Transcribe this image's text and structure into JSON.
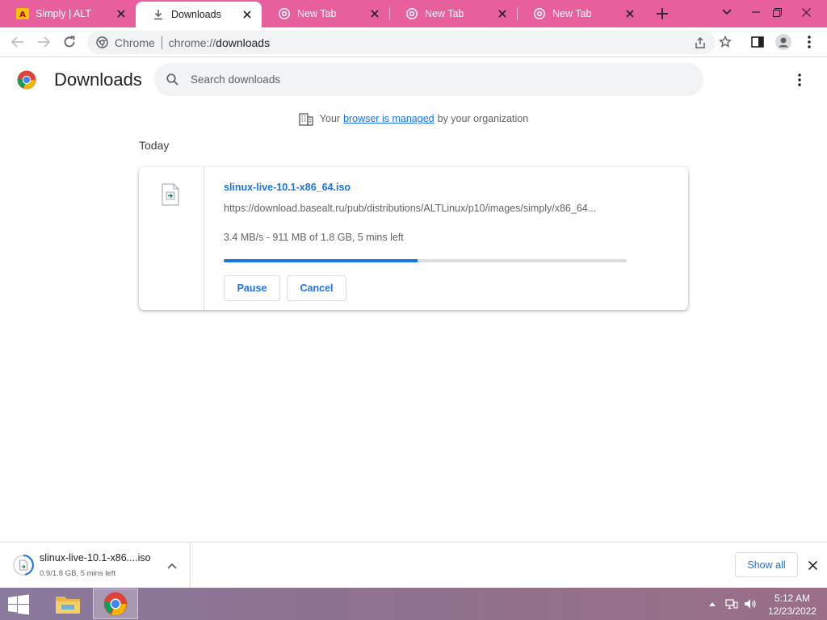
{
  "tabs": [
    {
      "title": "Simply | ALT",
      "icon": "alt-linux-icon",
      "active": false
    },
    {
      "title": "Downloads",
      "icon": "download-icon",
      "active": true
    },
    {
      "title": "New Tab",
      "icon": "chrome-icon",
      "active": false
    },
    {
      "title": "New Tab",
      "icon": "chrome-icon",
      "active": false
    },
    {
      "title": "New Tab",
      "icon": "chrome-icon",
      "active": false
    }
  ],
  "colors": {
    "tabstrip": "#e7609d",
    "accent": "#1a73e8",
    "progress_track": "#dadce0"
  },
  "omnibox": {
    "site_label": "Chrome",
    "url_scheme": "chrome://",
    "url_path": "downloads"
  },
  "page": {
    "title": "Downloads",
    "search_placeholder": "Search downloads"
  },
  "managed": {
    "prefix": "Your",
    "link": "browser is managed",
    "suffix": "by your organization"
  },
  "sections": {
    "today": "Today"
  },
  "download": {
    "filename": "slinux-live-10.1-x86_64.iso",
    "url": "https://download.basealt.ru/pub/distributions/ALTLinux/p10/images/simply/x86_64...",
    "status": "3.4 MB/s - 911 MB of 1.8 GB, 5 mins left",
    "progress_fraction": 0.48,
    "pause_label": "Pause",
    "cancel_label": "Cancel"
  },
  "shelf": {
    "name": "slinux-live-10.1-x86....iso",
    "sub": "0.9/1.8 GB, 5 mins left",
    "show_all": "Show all"
  },
  "taskbar": {
    "time": "5:12 AM",
    "date": "12/23/2022"
  }
}
